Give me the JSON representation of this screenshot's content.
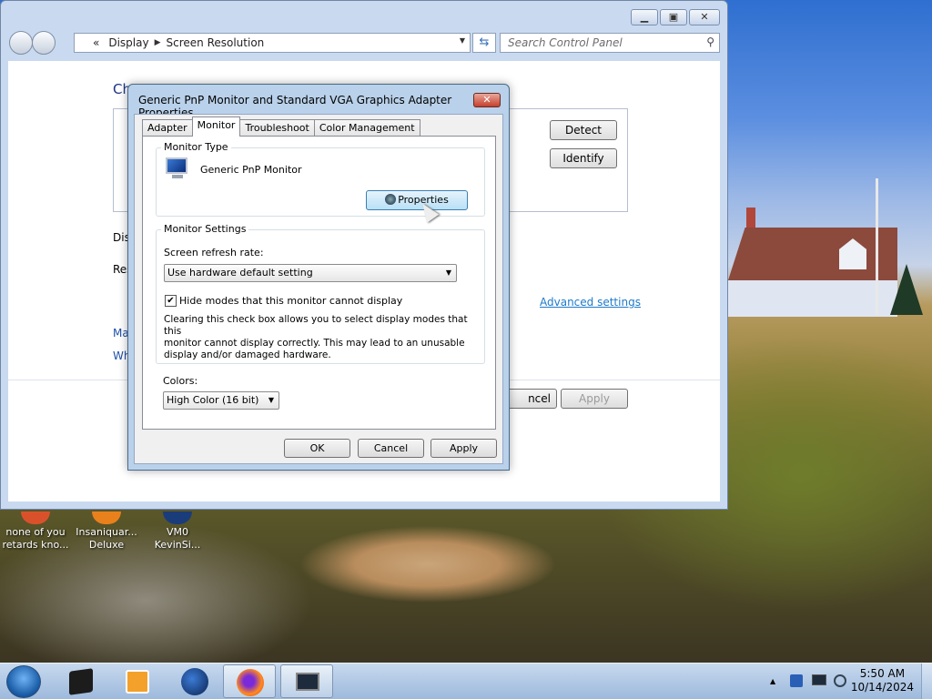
{
  "control_panel": {
    "breadcrumb_prefix": "«",
    "breadcrumb": [
      "Display",
      "Screen Resolution"
    ],
    "search_placeholder": "Search Control Panel",
    "heading_partial": "Ch",
    "detect_label": "Detect",
    "identify_label": "Identify",
    "display_partial": "Dis",
    "resolution_partial": "Res",
    "advanced_settings_link": "Advanced settings",
    "link1_partial": "Ma",
    "link2_partial": "Wh",
    "cancel_partial": "ncel",
    "apply_label": "Apply"
  },
  "dialog": {
    "title": "Generic PnP Monitor and Standard VGA Graphics Adapter Properties",
    "close_label": "✕",
    "tabs": [
      {
        "label": "Adapter",
        "active": false
      },
      {
        "label": "Monitor",
        "active": true
      },
      {
        "label": "Troubleshoot",
        "active": false
      },
      {
        "label": "Color Management",
        "active": false
      }
    ],
    "monitor_type": {
      "group_title": "Monitor Type",
      "monitor_name": "Generic PnP Monitor",
      "properties_button": "Properties"
    },
    "monitor_settings": {
      "group_title": "Monitor Settings",
      "refresh_label": "Screen refresh rate:",
      "refresh_value": "Use hardware default setting",
      "hide_modes_checked": true,
      "hide_modes_label": "Hide modes that this monitor cannot display",
      "description_lines": [
        "Clearing this check box allows you to select display modes that this",
        "monitor cannot display correctly. This may lead to an unusable",
        "display and/or damaged hardware."
      ]
    },
    "colors": {
      "label": "Colors:",
      "value": "High Color (16 bit)"
    },
    "buttons": {
      "ok": "OK",
      "cancel": "Cancel",
      "apply": "Apply"
    }
  },
  "desktop_icons": [
    {
      "line1": "none of you",
      "line2": "retards kno...",
      "icon": "red-orange-app-icon"
    },
    {
      "line1": "Insaniquar...",
      "line2": "Deluxe",
      "icon": "orange-game-icon"
    },
    {
      "line1": "VM0",
      "line2": "KevinSi...",
      "icon": "blue-app-icon"
    }
  ],
  "taskbar": {
    "apps": [
      "media-player-icon",
      "video-player-icon",
      "globe-browser-icon",
      "firefox-icon",
      "display-settings-icon"
    ],
    "time": "5:50 AM",
    "date": "10/14/2024",
    "tray_chevron": "▲"
  }
}
